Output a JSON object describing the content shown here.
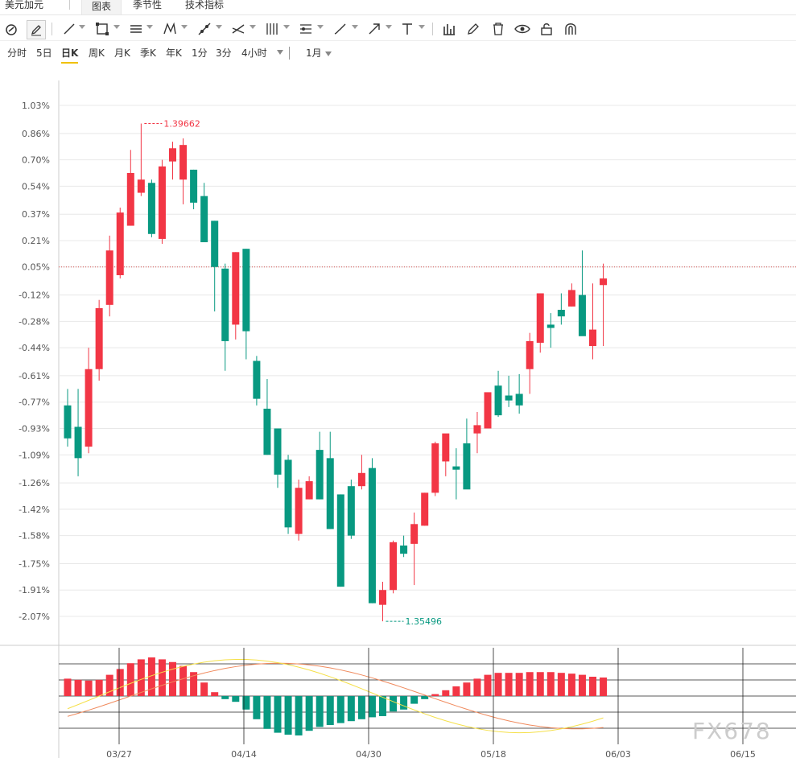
{
  "tabs": {
    "symbol": "美元加元",
    "chart": "图表",
    "seasonal": "季节性",
    "indicators": "技术指标"
  },
  "periods": {
    "items": [
      "分时",
      "5日",
      "日K",
      "周K",
      "月K",
      "季K",
      "年K",
      "1分",
      "3分",
      "4小时"
    ],
    "active": "日K",
    "range": "1月"
  },
  "toolbar_icons": [
    "magnet-circle-icon",
    "pencil-icon",
    "line-icon",
    "rectangle-icon",
    "parallel-lines-icon",
    "pattern-icon",
    "ray-icon",
    "fork-icon",
    "gann-icon",
    "fib-icon",
    "brush-icon",
    "arrow-icon",
    "text-icon",
    "bar-stats-icon",
    "edit-icon",
    "trash-icon",
    "eye-icon",
    "lock-icon",
    "magnet-icon"
  ],
  "colors": {
    "up": "#f23645",
    "down": "#089981",
    "grid": "#e8e8e8",
    "refline": "#d9534f",
    "ma_fast": "#f5e04a",
    "ma_slow": "#f08a5d"
  },
  "chart_data": {
    "type": "candlestick",
    "y_unit": "%",
    "yticks": [
      "1.03%",
      "0.86%",
      "0.70%",
      "0.54%",
      "0.37%",
      "0.21%",
      "0.05%",
      "-0.12%",
      "-0.28%",
      "-0.44%",
      "-0.61%",
      "-0.77%",
      "-0.93%",
      "-1.09%",
      "-1.26%",
      "-1.42%",
      "-1.58%",
      "-1.75%",
      "-1.91%",
      "-2.07%"
    ],
    "ylim": [
      -2.15,
      1.12
    ],
    "xticks": [
      "03/27",
      "04/14",
      "04/30",
      "05/18",
      "06/03",
      "06/15"
    ],
    "reference_line": 0.05,
    "annotations": [
      {
        "label": "1.39662",
        "value": 0.92,
        "type": "high"
      },
      {
        "label": "1.35496",
        "value": -2.1,
        "type": "low"
      }
    ],
    "ohlc": [
      [
        -0.79,
        -0.99,
        -1.04,
        -0.69
      ],
      [
        -0.92,
        -1.11,
        -1.22,
        -0.69
      ],
      [
        -1.04,
        -0.57,
        -1.08,
        -0.44
      ],
      [
        -0.57,
        -0.2,
        -0.64,
        -0.15
      ],
      [
        -0.18,
        0.15,
        -0.25,
        0.24
      ],
      [
        0.0,
        0.38,
        -0.02,
        0.41
      ],
      [
        0.3,
        0.62,
        0.3,
        0.76
      ],
      [
        0.5,
        0.58,
        0.48,
        0.92
      ],
      [
        0.56,
        0.25,
        0.23,
        0.58
      ],
      [
        0.22,
        0.66,
        0.19,
        0.7
      ],
      [
        0.69,
        0.77,
        0.58,
        0.81
      ],
      [
        0.58,
        0.79,
        0.43,
        0.83
      ],
      [
        0.64,
        0.44,
        0.4,
        0.64
      ],
      [
        0.48,
        0.2,
        0.2,
        0.56
      ],
      [
        0.33,
        0.05,
        -0.22,
        0.33
      ],
      [
        0.04,
        -0.4,
        -0.58,
        0.07
      ],
      [
        -0.3,
        0.14,
        -0.39,
        0.14
      ],
      [
        0.16,
        -0.34,
        -0.51,
        0.16
      ],
      [
        -0.52,
        -0.75,
        -0.79,
        -0.49
      ],
      [
        -0.81,
        -1.09,
        -1.09,
        -0.63
      ],
      [
        -0.93,
        -1.21,
        -1.29,
        -0.93
      ],
      [
        -1.12,
        -1.53,
        -1.57,
        -1.09
      ],
      [
        -1.57,
        -1.29,
        -1.61,
        -1.24
      ],
      [
        -1.36,
        -1.25,
        -1.36,
        -1.22
      ],
      [
        -1.06,
        -1.36,
        -1.36,
        -0.95
      ],
      [
        -1.11,
        -1.54,
        -1.54,
        -0.95
      ],
      [
        -1.33,
        -1.89,
        -1.89,
        -1.33
      ],
      [
        -1.28,
        -1.58,
        -1.6,
        -1.24
      ],
      [
        -1.28,
        -1.2,
        -1.3,
        -1.09
      ],
      [
        -1.17,
        -1.99,
        -1.99,
        -1.11
      ],
      [
        -2.0,
        -1.91,
        -2.1,
        -1.86
      ],
      [
        -1.91,
        -1.62,
        -1.93,
        -1.61
      ],
      [
        -1.64,
        -1.69,
        -1.71,
        -1.58
      ],
      [
        -1.63,
        -1.51,
        -1.88,
        -1.44
      ],
      [
        -1.52,
        -1.32,
        -1.52,
        -1.32
      ],
      [
        -1.32,
        -1.02,
        -1.34,
        -1.01
      ],
      [
        -1.13,
        -0.96,
        -1.22,
        -1.02
      ],
      [
        -1.16,
        -1.18,
        -1.36,
        -1.05
      ],
      [
        -1.02,
        -1.3,
        -1.28,
        -0.87
      ],
      [
        -0.96,
        -0.91,
        -1.08,
        -0.83
      ],
      [
        -0.93,
        -0.71,
        -0.83,
        -0.75
      ],
      [
        -0.67,
        -0.85,
        -0.86,
        -0.58
      ],
      [
        -0.73,
        -0.76,
        -0.8,
        -0.61
      ],
      [
        -0.72,
        -0.79,
        -0.84,
        -0.6
      ],
      [
        -0.57,
        -0.4,
        -0.72,
        -0.35
      ],
      [
        -0.41,
        -0.11,
        -0.47,
        -0.11
      ],
      [
        -0.3,
        -0.32,
        -0.44,
        -0.23
      ],
      [
        -0.21,
        -0.25,
        -0.3,
        -0.11
      ],
      [
        -0.19,
        -0.09,
        -0.19,
        -0.05
      ],
      [
        -0.12,
        -0.37,
        -0.36,
        0.15
      ],
      [
        -0.43,
        -0.33,
        -0.51,
        -0.05
      ],
      [
        -0.06,
        -0.02,
        -0.43,
        0.07
      ]
    ],
    "macd_hist": [
      0.45,
      0.42,
      0.4,
      0.42,
      0.55,
      0.7,
      0.85,
      0.95,
      1.0,
      0.95,
      0.88,
      0.78,
      0.62,
      0.35,
      0.1,
      -0.08,
      -0.15,
      -0.35,
      -0.6,
      -0.85,
      -0.95,
      -1.0,
      -1.02,
      -0.9,
      -0.8,
      -0.75,
      -0.7,
      -0.65,
      -0.6,
      -0.55,
      -0.52,
      -0.4,
      -0.35,
      -0.2,
      -0.08,
      0.05,
      0.15,
      0.25,
      0.35,
      0.45,
      0.55,
      0.6,
      0.6,
      0.6,
      0.62,
      0.62,
      0.62,
      0.6,
      0.58,
      0.55,
      0.5,
      0.48
    ]
  },
  "watermark": "FX678"
}
